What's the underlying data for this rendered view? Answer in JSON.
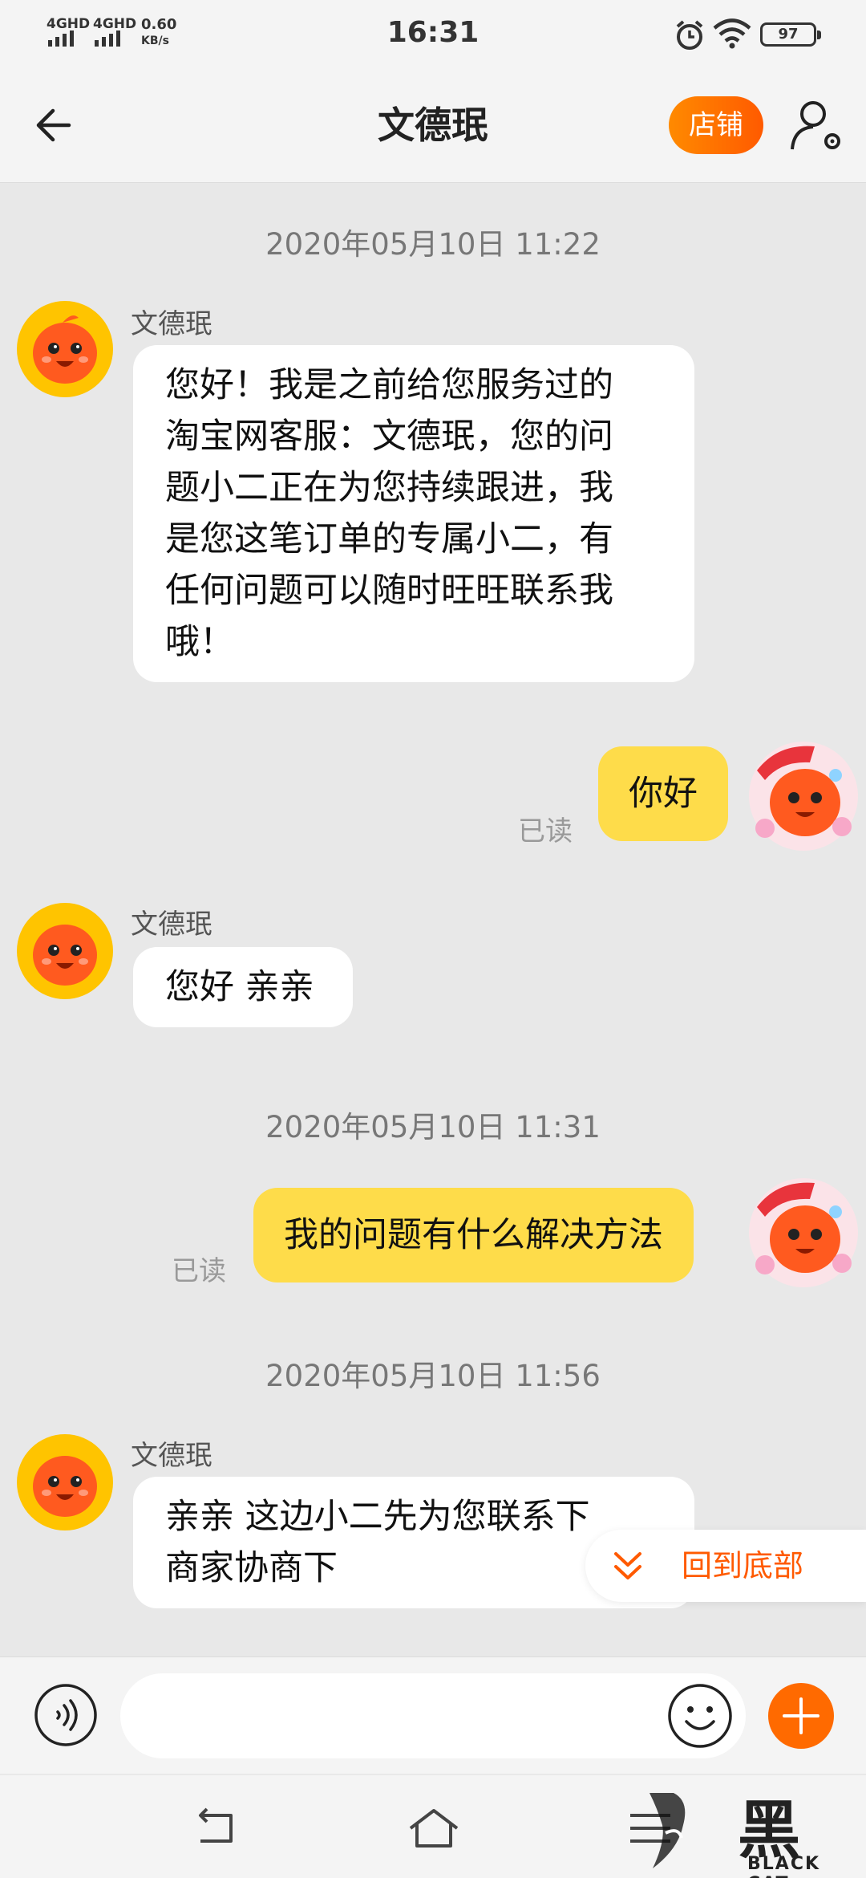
{
  "status_bar": {
    "network_1": "4GHD",
    "network_2": "4GHD",
    "speed": "0.60",
    "speed_unit": "KB/s",
    "time": "16:31",
    "battery": "97",
    "icons": [
      "signal-icon",
      "alarm-icon",
      "wifi-icon",
      "battery-icon"
    ]
  },
  "header": {
    "title": "文德珉",
    "store_label": "店铺",
    "icons": [
      "back-arrow-icon",
      "profile-settings-icon"
    ]
  },
  "messages": [
    {
      "type": "timestamp",
      "text": "2020年05月10日 11:22"
    },
    {
      "type": "in",
      "sender": "文德珉",
      "lines": [
        "您好！我是之前给您服务过的",
        "淘宝网客服：文德珉，您的问",
        "题小二正在为您持续跟进，我",
        "是您这笔订单的专属小二，有",
        "任何问题可以随时旺旺联系我",
        "哦！"
      ]
    },
    {
      "type": "out",
      "text": "你好",
      "status": "已读"
    },
    {
      "type": "in",
      "sender": "文德珉",
      "lines": [
        "您好 亲亲"
      ]
    },
    {
      "type": "timestamp",
      "text": "2020年05月10日 11:31"
    },
    {
      "type": "out",
      "text": "我的问题有什么解决方法",
      "status": "已读"
    },
    {
      "type": "timestamp",
      "text": "2020年05月10日 11:56"
    },
    {
      "type": "in",
      "sender": "文德珉",
      "lines": [
        "亲亲 这边小二先为您联系下",
        "商家协商下"
      ]
    }
  ],
  "back_to_bottom": {
    "label": "回到底部",
    "icon": "double-chevron-down-icon"
  },
  "input_bar": {
    "placeholder": "",
    "icons": [
      "voice-icon",
      "emoji-icon",
      "plus-icon"
    ]
  },
  "nav_bar": {
    "icons": [
      "nav-back-icon",
      "nav-home-icon",
      "nav-menu-icon"
    ]
  },
  "watermark": {
    "text": "黑猫",
    "sub": "BLACK CAT"
  },
  "colors": {
    "accent": "#ff6a00",
    "outgoing_bubble": "#fedc4a",
    "background": "#e8e8e8"
  }
}
